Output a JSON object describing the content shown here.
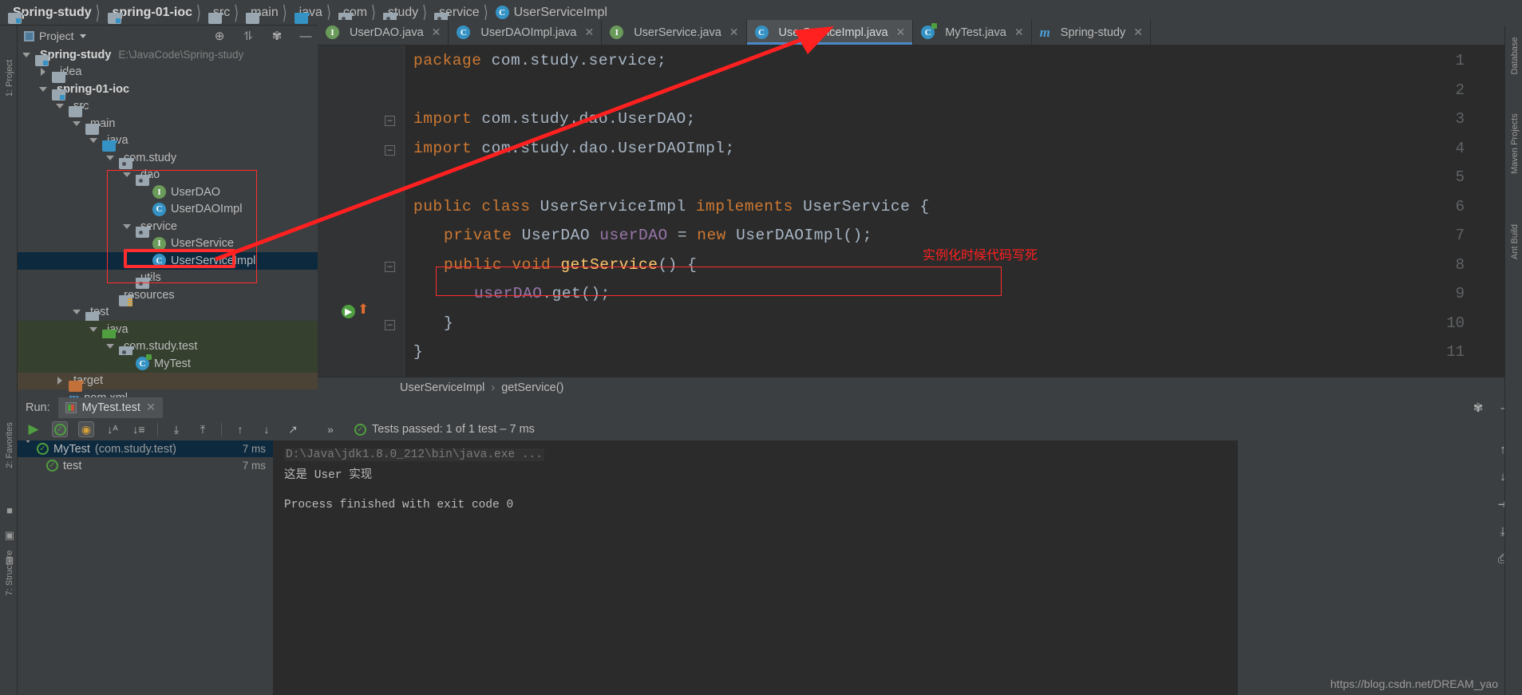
{
  "breadcrumb": [
    {
      "label": "Spring-study",
      "icon": "module-folder-icon",
      "bold": true
    },
    {
      "label": "spring-01-ioc",
      "icon": "module-folder-icon",
      "bold": true
    },
    {
      "label": "src",
      "icon": "folder-icon",
      "bold": false
    },
    {
      "label": "main",
      "icon": "folder-icon",
      "bold": false
    },
    {
      "label": "java",
      "icon": "source-folder-icon",
      "bold": false
    },
    {
      "label": "com",
      "icon": "package-icon",
      "bold": false
    },
    {
      "label": "study",
      "icon": "package-icon",
      "bold": false
    },
    {
      "label": "service",
      "icon": "package-icon",
      "bold": false
    },
    {
      "label": "UserServiceImpl",
      "icon": "class-icon",
      "bold": false
    }
  ],
  "project_panel": {
    "title": "Project",
    "toolbar_icons": [
      "locate-icon",
      "collapse-all-icon",
      "settings-gear-icon",
      "hide-icon"
    ],
    "tree": [
      {
        "depth": 0,
        "arrow": "down",
        "icon": "module-folder-icon",
        "label": "Spring-study",
        "path": "E:\\JavaCode\\Spring-study",
        "bold": true,
        "bg": "none"
      },
      {
        "depth": 1,
        "arrow": "right",
        "icon": "folder-icon",
        "label": ".idea",
        "path": "",
        "bold": false,
        "bg": "none"
      },
      {
        "depth": 1,
        "arrow": "down",
        "icon": "module-folder-icon",
        "label": "spring-01-ioc",
        "path": "",
        "bold": true,
        "bg": "none"
      },
      {
        "depth": 2,
        "arrow": "down",
        "icon": "folder-icon",
        "label": "src",
        "path": "",
        "bold": false,
        "bg": "none"
      },
      {
        "depth": 3,
        "arrow": "down",
        "icon": "folder-icon",
        "label": "main",
        "path": "",
        "bold": false,
        "bg": "none"
      },
      {
        "depth": 4,
        "arrow": "down",
        "icon": "source-folder-icon",
        "label": "java",
        "path": "",
        "bold": false,
        "bg": "none"
      },
      {
        "depth": 5,
        "arrow": "down",
        "icon": "package-icon",
        "label": "com.study",
        "path": "",
        "bold": false,
        "bg": "none"
      },
      {
        "depth": 6,
        "arrow": "down",
        "icon": "package-icon",
        "label": "dao",
        "path": "",
        "bold": false,
        "bg": "none"
      },
      {
        "depth": 7,
        "arrow": "none",
        "icon": "interface-icon",
        "label": "UserDAO",
        "path": "",
        "bold": false,
        "bg": "none"
      },
      {
        "depth": 7,
        "arrow": "none",
        "icon": "class-icon",
        "label": "UserDAOImpl",
        "path": "",
        "bold": false,
        "bg": "none"
      },
      {
        "depth": 6,
        "arrow": "down",
        "icon": "package-icon",
        "label": "service",
        "path": "",
        "bold": false,
        "bg": "none"
      },
      {
        "depth": 7,
        "arrow": "none",
        "icon": "interface-icon",
        "label": "UserService",
        "path": "",
        "bold": false,
        "bg": "none"
      },
      {
        "depth": 7,
        "arrow": "none",
        "icon": "class-icon",
        "label": "UserServiceImpl",
        "path": "",
        "bold": false,
        "bg": "selected"
      },
      {
        "depth": 6,
        "arrow": "none",
        "icon": "package-icon",
        "label": "utils",
        "path": "",
        "bold": false,
        "bg": "none"
      },
      {
        "depth": 5,
        "arrow": "none",
        "icon": "resources-folder-icon",
        "label": "resources",
        "path": "",
        "bold": false,
        "bg": "none"
      },
      {
        "depth": 3,
        "arrow": "down",
        "icon": "folder-icon",
        "label": "test",
        "path": "",
        "bold": false,
        "bg": "none"
      },
      {
        "depth": 4,
        "arrow": "down",
        "icon": "test-source-folder-icon",
        "label": "java",
        "path": "",
        "bold": false,
        "bg": "green"
      },
      {
        "depth": 5,
        "arrow": "down",
        "icon": "package-icon",
        "label": "com.study.test",
        "path": "",
        "bold": false,
        "bg": "green"
      },
      {
        "depth": 6,
        "arrow": "none",
        "icon": "test-class-icon",
        "label": "MyTest",
        "path": "",
        "bold": false,
        "bg": "green"
      },
      {
        "depth": 2,
        "arrow": "right",
        "icon": "target-folder-icon",
        "label": "target",
        "path": "",
        "bold": false,
        "bg": "brown"
      },
      {
        "depth": 2,
        "arrow": "none",
        "icon": "maven-pom-icon",
        "label": "pom.xml",
        "path": "",
        "bold": false,
        "bg": "none"
      }
    ]
  },
  "editor_tabs": [
    {
      "label": "UserDAO.java",
      "icon": "interface-icon",
      "active": false,
      "closable": true
    },
    {
      "label": "UserDAOImpl.java",
      "icon": "class-icon",
      "active": false,
      "closable": true
    },
    {
      "label": "UserService.java",
      "icon": "interface-icon",
      "active": false,
      "closable": true
    },
    {
      "label": "UserServiceImpl.java",
      "icon": "class-icon",
      "active": true,
      "closable": true
    },
    {
      "label": "MyTest.java",
      "icon": "test-class-icon",
      "active": false,
      "closable": true
    },
    {
      "label": "Spring-study",
      "icon": "maven-icon",
      "active": false,
      "closable": true
    }
  ],
  "editor": {
    "lines": [
      {
        "n": "1",
        "fold": false,
        "tokens": [
          {
            "t": "package ",
            "c": "kw"
          },
          {
            "t": "com.study.service;",
            "c": "ty"
          }
        ]
      },
      {
        "n": "2",
        "fold": false,
        "tokens": []
      },
      {
        "n": "3",
        "fold": true,
        "tokens": [
          {
            "t": "import ",
            "c": "kw"
          },
          {
            "t": "com.study.dao.UserDAO;",
            "c": "ty"
          }
        ]
      },
      {
        "n": "4",
        "fold": true,
        "tokens": [
          {
            "t": "import ",
            "c": "kw"
          },
          {
            "t": "com.study.dao.UserDAOImpl;",
            "c": "ty"
          }
        ]
      },
      {
        "n": "5",
        "fold": false,
        "tokens": []
      },
      {
        "n": "6",
        "fold": false,
        "tokens": [
          {
            "t": "public class ",
            "c": "kw"
          },
          {
            "t": "UserServiceImpl ",
            "c": "ty"
          },
          {
            "t": "implements ",
            "c": "kw"
          },
          {
            "t": "UserService {",
            "c": "ty"
          }
        ]
      },
      {
        "n": "7",
        "fold": false,
        "indent": 1,
        "tokens": [
          {
            "t": "private ",
            "c": "kw"
          },
          {
            "t": "UserDAO ",
            "c": "ty"
          },
          {
            "t": "userDAO",
            "c": "fld"
          },
          {
            "t": " = ",
            "c": "ty"
          },
          {
            "t": "new ",
            "c": "kw"
          },
          {
            "t": "UserDAOImpl();",
            "c": "ty"
          }
        ]
      },
      {
        "n": "8",
        "fold": true,
        "indent": 1,
        "tokens": [
          {
            "t": "public void ",
            "c": "kw"
          },
          {
            "t": "getService",
            "c": "mth"
          },
          {
            "t": "() {",
            "c": "ty"
          }
        ]
      },
      {
        "n": "9",
        "fold": false,
        "indent": 2,
        "tokens": [
          {
            "t": "userDAO",
            "c": "fld"
          },
          {
            "t": ".get();",
            "c": "ty"
          }
        ]
      },
      {
        "n": "10",
        "fold": true,
        "indent": 1,
        "tokens": [
          {
            "t": "}",
            "c": "ty"
          }
        ]
      },
      {
        "n": "11",
        "fold": false,
        "tokens": [
          {
            "t": "}",
            "c": "ty"
          }
        ]
      }
    ],
    "annotation_red": "实例化时候代码写死",
    "breadcrumb": [
      "UserServiceImpl",
      "getService()"
    ],
    "gutter_run_line": "8"
  },
  "run_panel": {
    "label": "Run:",
    "tab": "MyTest.test",
    "toolbar": {
      "rerun_icon": "run-icon",
      "buttons": [
        "show-passed-toggle",
        "show-ignored-toggle",
        "sort-alphabetically-icon",
        "sort-duration-icon",
        "expand-all-icon",
        "collapse-all-icon",
        "prev-failed-icon",
        "next-failed-icon",
        "export-icon",
        "more-icon"
      ]
    },
    "status": "Tests passed: 1 of 1 test – 7 ms",
    "tree": [
      {
        "depth": 0,
        "arrow": "down",
        "label": "MyTest",
        "pkg": "(com.study.test)",
        "time": "7 ms",
        "selected": true
      },
      {
        "depth": 1,
        "arrow": "none",
        "label": "test",
        "pkg": "",
        "time": "7 ms",
        "selected": false
      }
    ],
    "console": [
      {
        "text": "D:\\Java\\jdk1.8.0_212\\bin\\java.exe ...",
        "dim": true
      },
      {
        "text": "这是 User 实现",
        "dim": false
      },
      {
        "text": "",
        "dim": false
      },
      {
        "text": "Process finished with exit code 0",
        "dim": false
      }
    ],
    "right_icons": [
      "scroll-up-icon",
      "scroll-down-icon",
      "soft-wrap-icon",
      "scroll-to-end-icon",
      "print-icon"
    ],
    "header_right_icons": [
      "settings-gear-icon",
      "hide-icon"
    ]
  },
  "left_stripe": {
    "labels": [
      "1: Project",
      "2: Favorites",
      "7: Structure"
    ]
  },
  "right_stripe": {
    "labels": [
      "Database",
      "Maven Projects",
      "Ant Build"
    ]
  },
  "watermark": "https://blog.csdn.net/DREAM_yao",
  "colors": {
    "accent_blue": "#4a88c7",
    "selection": "#0d293e",
    "annotation_red": "#ff2020",
    "editor_bg": "#2b2b2b",
    "panel_bg": "#3c3f41"
  }
}
